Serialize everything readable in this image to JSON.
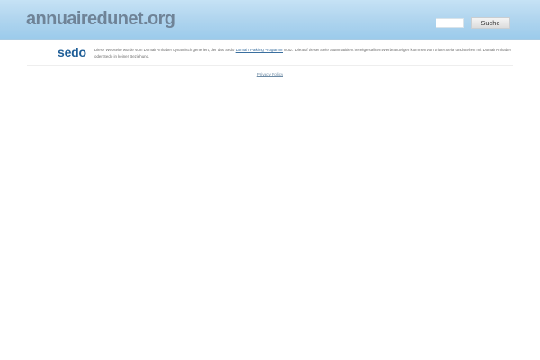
{
  "header": {
    "site_title": "annuairedunet.org",
    "search_placeholder": "",
    "search_value": "",
    "search_button_label": "Suche"
  },
  "info": {
    "logo_text": "sedo",
    "disclaimer_part1": "Diese Webseite wurde vom Domain-Inhaber dynamisch generiert, der das Sedo ",
    "disclaimer_link": "Domain Parking Programm",
    "disclaimer_part2": " nutzt. Die auf dieser Seite automatisiert bereitgestellten Werbeanzeigen kommen von dritter Seite und stehen mit Domain-Inhaber oder Sedo in keiner Beziehung."
  },
  "footer": {
    "privacy_label": "Privacy Policy"
  },
  "colors": {
    "header_gradient_top": "#c6e2f5",
    "header_gradient_bottom": "#9ccbeb",
    "title_color": "#6f8397",
    "sedo_blue": "#1f5e97",
    "link_color": "#3a6f9f"
  }
}
